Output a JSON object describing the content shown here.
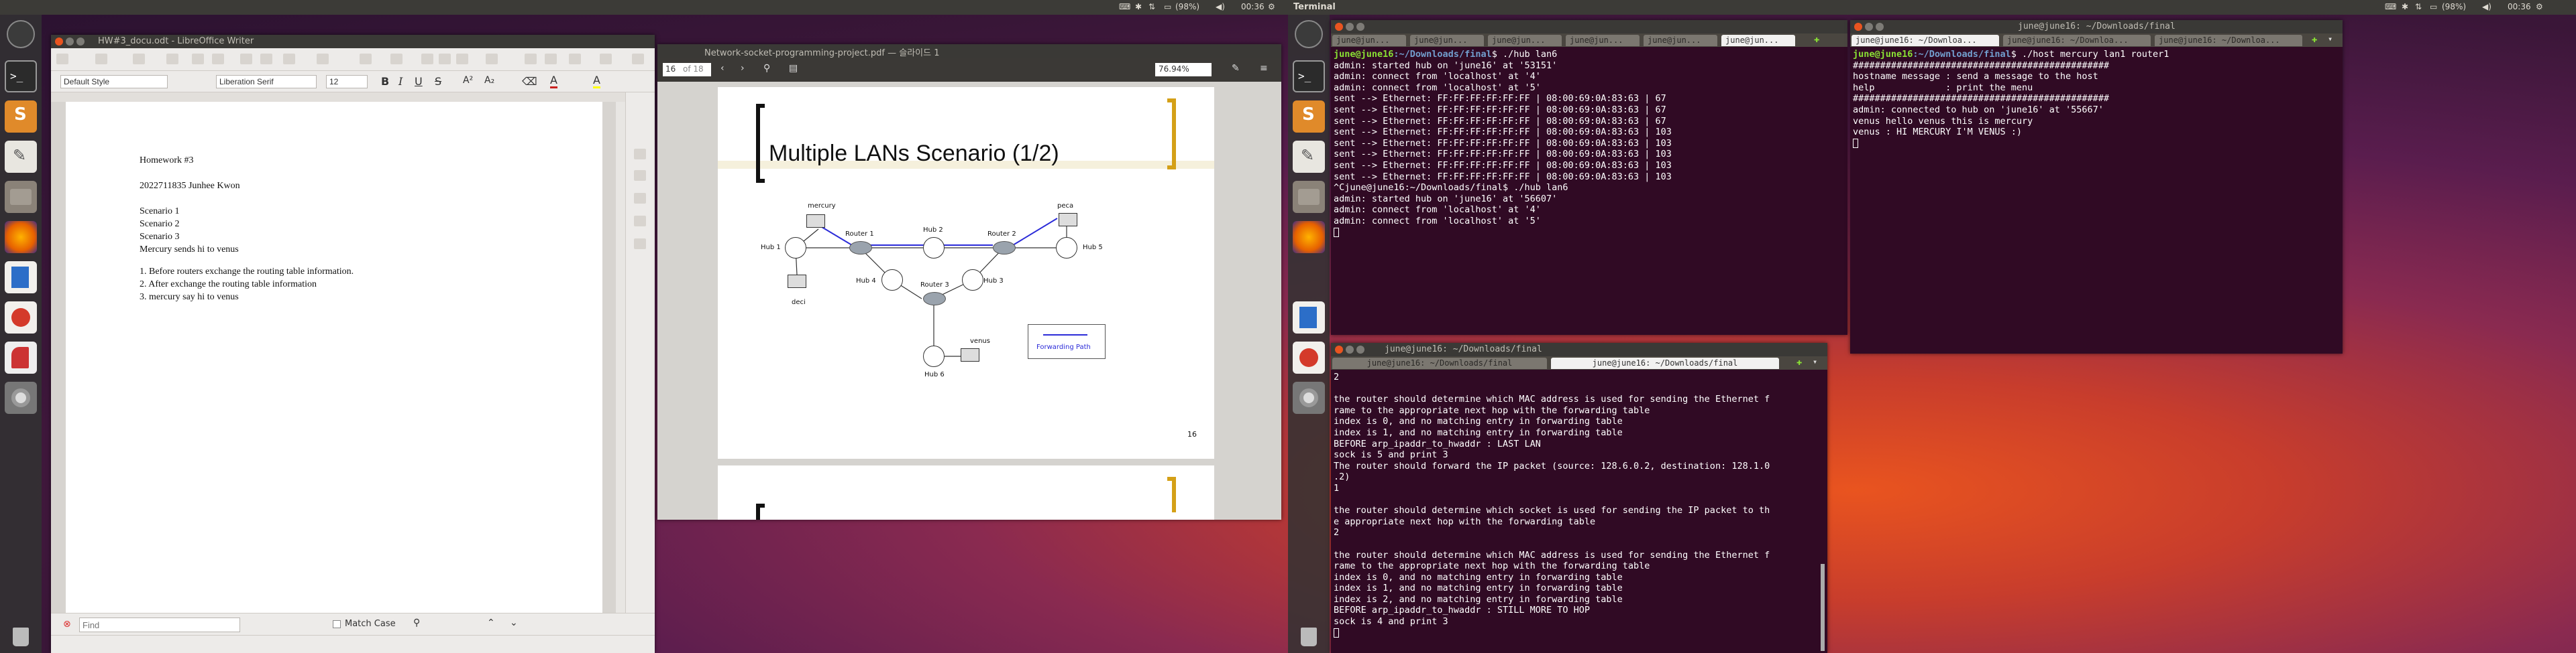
{
  "topbar": {
    "app_title": "Terminal",
    "battery": "(98%)",
    "time": "00:36",
    "battery2": "(98%)",
    "time2": "00:36"
  },
  "writer": {
    "title": "HW#3_docu.odt - LibreOffice Writer",
    "para_style": "Default Style",
    "font_name": "Liberation Serif",
    "font_size": "12",
    "doc_lines": [
      "Homework #3",
      "2022711835 Junhee Kwon",
      "Scenario 1",
      "Scenario 2",
      "Scenario 3",
      "Mercury sends hi to venus",
      "1. Before routers exchange the routing table information.",
      "2. After exchange the routing table information",
      "3. mercury say hi to venus"
    ],
    "find_placeholder": "Find",
    "match_case": "Match Case"
  },
  "pdf": {
    "title": "Network-socket-programming-project.pdf — 슬라이드 1",
    "page": "16",
    "of": "of 18",
    "zoom": "76.94%",
    "slide_title": "Multiple LANs Scenario (1/2)",
    "slide_number": "16",
    "nodes": {
      "mercury": "mercury",
      "peca": "peca",
      "deci": "deci",
      "venus": "venus",
      "hub1": "Hub 1",
      "hub2": "Hub 2",
      "hub3": "Hub 3",
      "hub4": "Hub 4",
      "hub5": "Hub 5",
      "hub6": "Hub 6",
      "router1": "Router 1",
      "router2": "Router 2",
      "router3": "Router 3"
    },
    "legend": "Forwarding Path"
  },
  "term1": {
    "title": "",
    "tabs": [
      "june@jun...",
      "june@jun...",
      "june@jun...",
      "june@jun...",
      "june@jun...",
      "june@jun..."
    ],
    "prompt_user": "june@june16",
    "prompt_path": ":~/Downloads/final",
    "lines": [
      {
        "p": true,
        "cmd": "$ ./hub lan6"
      },
      {
        "t": "admin: started hub on 'june16' at '53151'"
      },
      {
        "t": "admin: connect from 'localhost' at '4'"
      },
      {
        "t": "admin: connect from 'localhost' at '5'"
      },
      {
        "t": "sent --> Ethernet: FF:FF:FF:FF:FF:FF | 08:00:69:0A:83:63 | 67"
      },
      {
        "t": "sent --> Ethernet: FF:FF:FF:FF:FF:FF | 08:00:69:0A:83:63 | 67"
      },
      {
        "t": "sent --> Ethernet: FF:FF:FF:FF:FF:FF | 08:00:69:0A:83:63 | 67"
      },
      {
        "t": "sent --> Ethernet: FF:FF:FF:FF:FF:FF | 08:00:69:0A:83:63 | 103"
      },
      {
        "t": "sent --> Ethernet: FF:FF:FF:FF:FF:FF | 08:00:69:0A:83:63 | 103"
      },
      {
        "t": "sent --> Ethernet: FF:FF:FF:FF:FF:FF | 08:00:69:0A:83:63 | 103"
      },
      {
        "t": "sent --> Ethernet: FF:FF:FF:FF:FF:FF | 08:00:69:0A:83:63 | 103"
      },
      {
        "t": "sent --> Ethernet: FF:FF:FF:FF:FF:FF | 08:00:69:0A:83:63 | 103"
      },
      {
        "t": "^Cjune@june16:~/Downloads/final$ ./hub lan6"
      },
      {
        "t": "admin: started hub on 'june16' at '56607'"
      },
      {
        "t": "admin: connect from 'localhost' at '4'"
      },
      {
        "t": "admin: connect from 'localhost' at '5'"
      }
    ]
  },
  "term2": {
    "title": "june@june16: ~/Downloads/final",
    "tabs": [
      "june@june16: ~/Downloa...",
      "june@june16: ~/Downloa...",
      "june@june16: ~/Downloa..."
    ],
    "lines": [
      {
        "p": true,
        "cmd": "$ ./host mercury lan1 router1"
      },
      {
        "t": "###############################################"
      },
      {
        "t": "hostname message : send a message to the host"
      },
      {
        "t": "help             : print the menu"
      },
      {
        "t": "###############################################"
      },
      {
        "t": "admin: connected to hub on 'june16' at '55667'"
      },
      {
        "t": "venus hello venus this is mercury"
      },
      {
        "t": "venus : HI MERCURY I'M VENUS :)"
      }
    ]
  },
  "term3": {
    "title": "june@june16: ~/Downloads/final",
    "tabs": [
      "june@june16: ~/Downloads/final",
      "june@june16: ~/Downloads/final"
    ],
    "lines": [
      "2",
      "",
      "the router should determine which MAC address is used for sending the Ethernet f",
      "rame to the appropriate next hop with the forwarding table",
      "index is 0, and no matching entry in forwarding table",
      "index is 1, and no matching entry in forwarding table",
      "BEFORE arp_ipaddr_to_hwaddr : LAST LAN",
      "sock is 5 and print 3",
      "The router should forward the IP packet (source: 128.6.0.2, destination: 128.1.0",
      ".2)",
      "1",
      "",
      "the router should determine which socket is used for sending the IP packet to th",
      "e appropriate next hop with the forwarding table",
      "2",
      "",
      "the router should determine which MAC address is used for sending the Ethernet f",
      "rame to the appropriate next hop with the forwarding table",
      "index is 0, and no matching entry in forwarding table",
      "index is 1, and no matching entry in forwarding table",
      "index is 2, and no matching entry in forwarding table",
      "BEFORE arp_ipaddr_to_hwaddr : STILL MORE TO HOP",
      "sock is 4 and print 3"
    ]
  }
}
